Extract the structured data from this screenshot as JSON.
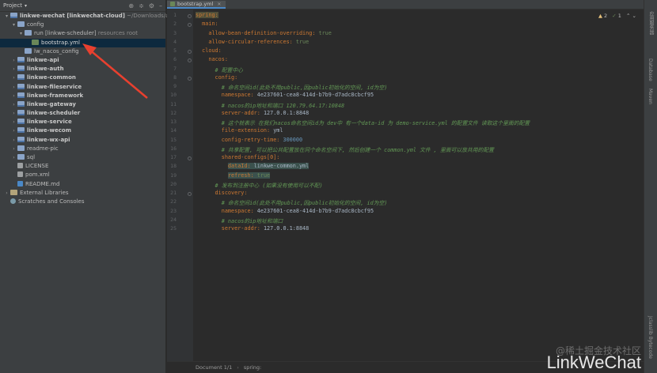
{
  "project_panel": {
    "title": "Project",
    "tree": [
      {
        "depth": 0,
        "arrow": "▾",
        "icon": "module",
        "label": "linkwe-wechat [linkwechat-cloud]",
        "suffix": "~/Downloads/aaa/lin",
        "bold": true
      },
      {
        "depth": 1,
        "arrow": "▾",
        "icon": "folder",
        "label": "config"
      },
      {
        "depth": 2,
        "arrow": "▾",
        "icon": "folder",
        "label": "run [linkwe-scheduler]",
        "suffix": "resources root"
      },
      {
        "depth": 3,
        "arrow": "",
        "icon": "yml",
        "label": "bootstrap.yml",
        "selected": true
      },
      {
        "depth": 2,
        "arrow": "",
        "icon": "folder",
        "label": "lw_nacos_config"
      },
      {
        "depth": 1,
        "arrow": "›",
        "icon": "module",
        "label": "linkwe-api",
        "bold": true
      },
      {
        "depth": 1,
        "arrow": "›",
        "icon": "module",
        "label": "linkwe-auth",
        "bold": true
      },
      {
        "depth": 1,
        "arrow": "›",
        "icon": "module",
        "label": "linkwe-common",
        "bold": true
      },
      {
        "depth": 1,
        "arrow": "›",
        "icon": "module",
        "label": "linkwe-fileservice",
        "bold": true
      },
      {
        "depth": 1,
        "arrow": "›",
        "icon": "module",
        "label": "linkwe-framework",
        "bold": true
      },
      {
        "depth": 1,
        "arrow": "›",
        "icon": "module",
        "label": "linkwe-gateway",
        "bold": true
      },
      {
        "depth": 1,
        "arrow": "›",
        "icon": "module",
        "label": "linkwe-scheduler",
        "bold": true
      },
      {
        "depth": 1,
        "arrow": "›",
        "icon": "module",
        "label": "linkwe-service",
        "bold": true
      },
      {
        "depth": 1,
        "arrow": "›",
        "icon": "module",
        "label": "linkwe-wecom",
        "bold": true
      },
      {
        "depth": 1,
        "arrow": "›",
        "icon": "module",
        "label": "linkwe-wx-api",
        "bold": true
      },
      {
        "depth": 1,
        "arrow": "›",
        "icon": "folder",
        "label": "readme-pic"
      },
      {
        "depth": 1,
        "arrow": "›",
        "icon": "folder",
        "label": "sql"
      },
      {
        "depth": 1,
        "arrow": "",
        "icon": "file",
        "label": "LICENSE"
      },
      {
        "depth": 1,
        "arrow": "",
        "icon": "file",
        "label": "pom.xml"
      },
      {
        "depth": 1,
        "arrow": "",
        "icon": "md",
        "label": "README.md"
      },
      {
        "depth": 0,
        "arrow": "›",
        "icon": "lib",
        "label": "External Libraries"
      },
      {
        "depth": 0,
        "arrow": "",
        "icon": "scratch",
        "label": "Scratches and Consoles"
      }
    ]
  },
  "editor": {
    "tab_label": "bootstrap.yml",
    "inspection": {
      "warnings": "2",
      "ok": "1"
    },
    "breadcrumb": [
      "Document 1/1",
      "spring:"
    ],
    "lines": [
      [
        {
          "t": "spring:",
          "c": "key hl-key"
        }
      ],
      [
        {
          "t": "  main:",
          "c": "key"
        }
      ],
      [
        {
          "t": "    allow-bean-definition-overriding: ",
          "c": "key"
        },
        {
          "t": "true",
          "c": "val"
        }
      ],
      [
        {
          "t": "    allow-circular-references: ",
          "c": "key"
        },
        {
          "t": "true",
          "c": "val"
        }
      ],
      [
        {
          "t": "  cloud:",
          "c": "key"
        }
      ],
      [
        {
          "t": "    nacos:",
          "c": "key"
        }
      ],
      [
        {
          "t": "      # 配置中心",
          "c": "cmt"
        }
      ],
      [
        {
          "t": "      config:",
          "c": "key"
        }
      ],
      [
        {
          "t": "        # 命名空间id(此处不用public,因public初始化的空间, id为空)",
          "c": "cmt"
        }
      ],
      [
        {
          "t": "        namespace: ",
          "c": "key"
        },
        {
          "t": "4e237601-cea8-414d-b7b9-d7adc8cbcf95",
          "c": "plain"
        }
      ],
      [
        {
          "t": "        # nacos的ip地址和端口 120.79.64.17:10848",
          "c": "cmt"
        }
      ],
      [
        {
          "t": "        server-addr: ",
          "c": "key"
        },
        {
          "t": "127.0.0.1:8848",
          "c": "plain"
        }
      ],
      [
        {
          "t": "        # 这个就表示 在我们nacos命名空间id为 dev中 有一个data-id 为 demo-service.yml 的配置文件 读取这个里面的配置",
          "c": "cmt"
        }
      ],
      [
        {
          "t": "        file-extension: ",
          "c": "key"
        },
        {
          "t": "yml",
          "c": "plain"
        }
      ],
      [
        {
          "t": "        config-retry-time: ",
          "c": "key"
        },
        {
          "t": "300000",
          "c": "num"
        }
      ],
      [
        {
          "t": "        # 共享配置, 可以把公共配置放在同个命名空间下, 然后创建一个 common.yml 文件 , 里面可以放共用的配置",
          "c": "cmt"
        }
      ],
      [
        {
          "t": "        shared-configs[0]:",
          "c": "key"
        }
      ],
      [
        {
          "t": "          ",
          "c": "plain"
        },
        {
          "t": "dataId: ",
          "c": "key hl"
        },
        {
          "t": "linkwe-common.yml",
          "c": "plain hl"
        }
      ],
      [
        {
          "t": "          ",
          "c": "plain"
        },
        {
          "t": "refresh: ",
          "c": "key hl"
        },
        {
          "t": "true",
          "c": "val hl"
        }
      ],
      [
        {
          "t": "      # 发布到注册中心 (如果没有使用可以不配)",
          "c": "cmt"
        }
      ],
      [
        {
          "t": "      discovery:",
          "c": "key"
        }
      ],
      [
        {
          "t": "        # 命名空间id(此处不用public,因public初始化的空间, id为空)",
          "c": "cmt"
        }
      ],
      [
        {
          "t": "        namespace: ",
          "c": "key"
        },
        {
          "t": "4e237601-cea8-414d-b7b9-d7adc8cbcf95",
          "c": "plain"
        }
      ],
      [
        {
          "t": "        # nacos的ip地址和端口",
          "c": "cmt"
        }
      ],
      [
        {
          "t": "        server-addr: ",
          "c": "key"
        },
        {
          "t": "127.0.0.1:8848",
          "c": "plain"
        }
      ]
    ]
  },
  "right_strip": [
    "应用服务器",
    "Database",
    "Maven",
    "Jclasslib Bytecode"
  ],
  "watermark": {
    "site": "@稀土掘金技术社区",
    "brand": "LinkWeChat"
  },
  "colors": {
    "arrow": "#e8402f",
    "selection": "#0d293e"
  }
}
